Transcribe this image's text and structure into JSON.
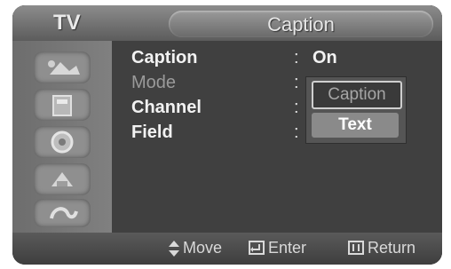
{
  "header": {
    "left_label": "TV",
    "title": "Caption"
  },
  "sidebar": {
    "icons": [
      "picture-icon",
      "sound-icon",
      "channel-icon",
      "setup-icon",
      "input-icon"
    ]
  },
  "menu": {
    "rows": [
      {
        "label": "Caption",
        "state": "active"
      },
      {
        "label": "Mode",
        "state": "dim"
      },
      {
        "label": "Channel",
        "state": "active"
      },
      {
        "label": "Field",
        "state": "active"
      }
    ],
    "caption_value": "On"
  },
  "dropdown": {
    "options": [
      "Caption",
      "Text"
    ],
    "selected": "Text"
  },
  "footer": {
    "move_label": "Move",
    "enter_label": "Enter",
    "return_label": "Return"
  }
}
